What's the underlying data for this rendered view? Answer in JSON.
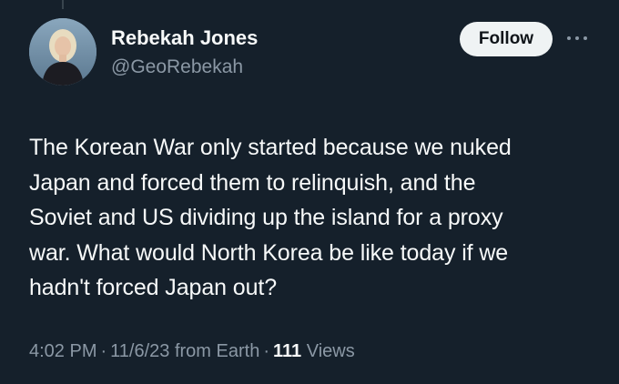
{
  "author": {
    "display_name": "Rebekah Jones",
    "handle": "@GeoRebekah",
    "avatar_icon": "profile-photo"
  },
  "actions": {
    "follow_label": "Follow",
    "more_icon": "more-horizontal-icon"
  },
  "tweet": {
    "text": "The Korean War only started because we nuked\nJapan and forced them to relinquish, and the\nSoviet and US dividing up the island for a proxy\nwar. What would North Korea be like today if we\nhadn't forced Japan out?"
  },
  "meta": {
    "time": "4:02 PM",
    "separator": "·",
    "date": "11/6/23",
    "source": "from Earth",
    "views_count": "111",
    "views_label": "Views"
  },
  "colors": {
    "background": "#15202b",
    "primary_text": "#f7f9f9",
    "secondary_text": "#8b98a5",
    "follow_bg": "#eff3f4"
  }
}
